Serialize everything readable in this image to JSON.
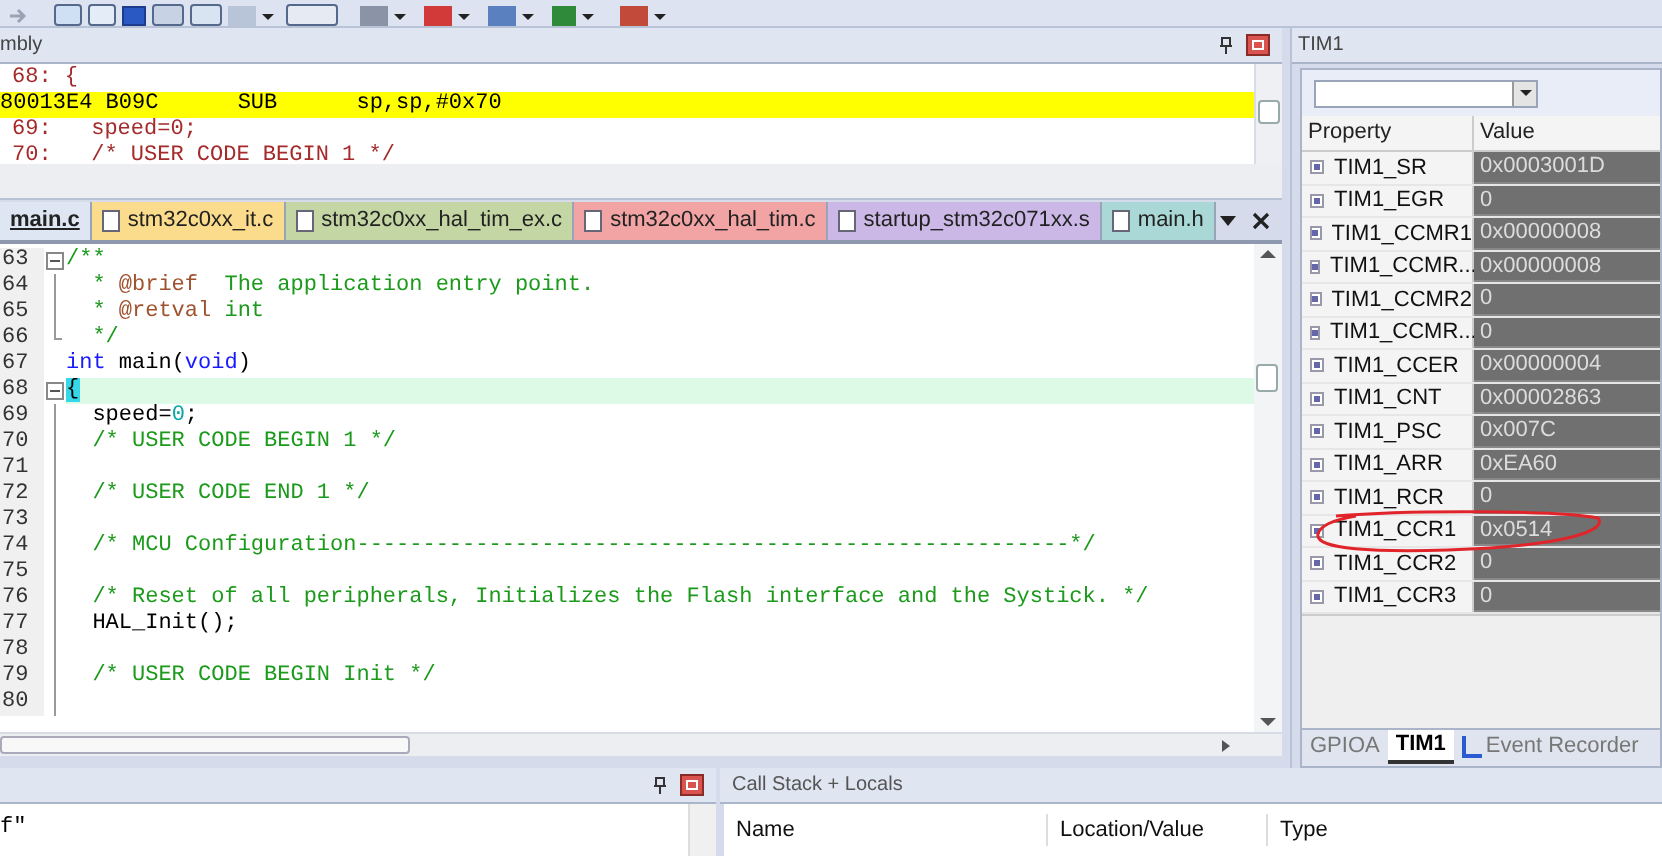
{
  "disassembly": {
    "title": "mbly",
    "lines": [
      {
        "kind": "source",
        "text": "68: {",
        "highlighted": false
      },
      {
        "kind": "instruction",
        "text": "80013E4 B09C      SUB      sp,sp,#0x70",
        "highlighted": true
      },
      {
        "kind": "source",
        "text": "69:   speed=0;",
        "highlighted": false
      },
      {
        "kind": "source",
        "text": "70:   /* USER CODE BEGIN 1 */",
        "highlighted": false
      }
    ]
  },
  "editor_tabs": [
    {
      "label": "main.c",
      "color": "#dfe6f3",
      "selected": true
    },
    {
      "label": "stm32c0xx_it.c",
      "color": "#fbdc8c",
      "selected": false
    },
    {
      "label": "stm32c0xx_hal_tim_ex.c",
      "color": "#c4d6a4",
      "selected": false
    },
    {
      "label": "stm32c0xx_hal_tim.c",
      "color": "#f2a3a3",
      "selected": false
    },
    {
      "label": "startup_stm32c071xx.s",
      "color": "#cbb8e6",
      "selected": false
    },
    {
      "label": "main.h",
      "color": "#a9d8d6",
      "selected": false
    }
  ],
  "code_lines": [
    {
      "number": "63",
      "kind": "start",
      "current": false,
      "tokens": [
        {
          "kind": "comment",
          "text": "/**"
        }
      ]
    },
    {
      "number": "64",
      "kind": "inside",
      "current": false,
      "tokens": [
        {
          "kind": "comment",
          "text": "  * "
        },
        {
          "kind": "tag",
          "text": "@brief"
        },
        {
          "kind": "comment",
          "text": "  The application entry point."
        }
      ]
    },
    {
      "number": "65",
      "kind": "inside",
      "current": false,
      "tokens": [
        {
          "kind": "comment",
          "text": "  * "
        },
        {
          "kind": "tag",
          "text": "@retval"
        },
        {
          "kind": "comment",
          "text": " int"
        }
      ]
    },
    {
      "number": "66",
      "kind": "end",
      "current": false,
      "tokens": [
        {
          "kind": "comment",
          "text": "  */"
        }
      ]
    },
    {
      "number": "67",
      "kind": "plain",
      "current": false,
      "tokens": [
        {
          "kind": "keyword",
          "text": "int"
        },
        {
          "kind": "plain",
          "text": " main("
        },
        {
          "kind": "keyword",
          "text": "void"
        },
        {
          "kind": "plain",
          "text": ")"
        }
      ]
    },
    {
      "number": "68",
      "kind": "start",
      "current": true,
      "tokens": [
        {
          "kind": "brace",
          "text": "{"
        }
      ]
    },
    {
      "number": "69",
      "kind": "inside",
      "current": false,
      "tokens": [
        {
          "kind": "plain",
          "text": "  speed="
        },
        {
          "kind": "number",
          "text": "0"
        },
        {
          "kind": "plain",
          "text": ";"
        }
      ]
    },
    {
      "number": "70",
      "kind": "inside",
      "current": false,
      "tokens": [
        {
          "kind": "comment",
          "text": "  /* USER CODE BEGIN 1 */"
        }
      ]
    },
    {
      "number": "71",
      "kind": "inside",
      "current": false
    },
    {
      "number": "72",
      "kind": "inside",
      "current": false,
      "tokens": [
        {
          "kind": "comment",
          "text": "  /* USER CODE END 1 */"
        }
      ]
    },
    {
      "number": "73",
      "kind": "inside",
      "current": false
    },
    {
      "number": "74",
      "kind": "inside",
      "current": false,
      "tokens": [
        {
          "kind": "comment",
          "text": "  /* MCU Configuration------------------------------------------------------*/"
        }
      ]
    },
    {
      "number": "75",
      "kind": "inside",
      "current": false
    },
    {
      "number": "76",
      "kind": "inside",
      "current": false,
      "tokens": [
        {
          "kind": "comment",
          "text": "  /* Reset of all peripherals, Initializes the Flash interface and the Systick. */"
        }
      ]
    },
    {
      "number": "77",
      "kind": "inside",
      "current": false,
      "tokens": [
        {
          "kind": "plain",
          "text": "  HAL_Init();"
        }
      ]
    },
    {
      "number": "78",
      "kind": "inside",
      "current": false
    },
    {
      "number": "79",
      "kind": "inside",
      "current": false,
      "tokens": [
        {
          "kind": "comment",
          "text": "  /* USER CODE BEGIN Init */"
        }
      ]
    },
    {
      "number": "80",
      "kind": "inside",
      "current": false
    }
  ],
  "peripheral_panel": {
    "title": "TIM1",
    "columns": [
      "Property",
      "Value"
    ],
    "registers": [
      {
        "name": "TIM1_SR",
        "value": "0x0003001D"
      },
      {
        "name": "TIM1_EGR",
        "value": "0"
      },
      {
        "name": "TIM1_CCMR1",
        "value": "0x00000008"
      },
      {
        "name": "TIM1_CCMR...",
        "value": "0x00000008"
      },
      {
        "name": "TIM1_CCMR2",
        "value": "0"
      },
      {
        "name": "TIM1_CCMR...",
        "value": "0"
      },
      {
        "name": "TIM1_CCER",
        "value": "0x00000004"
      },
      {
        "name": "TIM1_CNT",
        "value": "0x00002863"
      },
      {
        "name": "TIM1_PSC",
        "value": "0x007C"
      },
      {
        "name": "TIM1_ARR",
        "value": "0xEA60"
      },
      {
        "name": "TIM1_RCR",
        "value": "0"
      },
      {
        "name": "TIM1_CCR1",
        "value": "0x0514"
      },
      {
        "name": "TIM1_CCR2",
        "value": "0"
      },
      {
        "name": "TIM1_CCR3",
        "value": "0"
      }
    ],
    "tabs": [
      {
        "label": "GPIOA",
        "selected": false
      },
      {
        "label": "TIM1",
        "selected": true
      },
      {
        "label": "Event Recorder",
        "selected": false
      }
    ]
  },
  "watch_panel": {
    "text": "f\""
  },
  "call_stack": {
    "title": "Call Stack + Locals",
    "columns": [
      "Name",
      "Location/Value",
      "Type"
    ]
  }
}
